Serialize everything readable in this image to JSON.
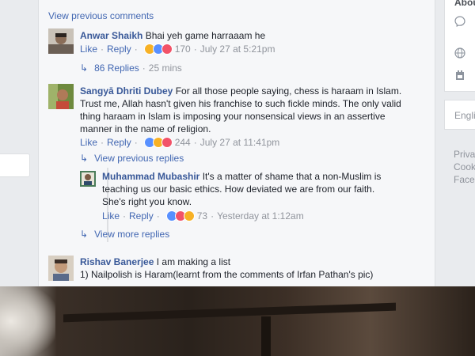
{
  "colors": {
    "link": "#4267b2",
    "author": "#385898",
    "meta": "#90949c",
    "background": "#e9ebee"
  },
  "view_previous_comments": "View previous comments",
  "actions": {
    "like": "Like",
    "reply": "Reply",
    "dot": "·"
  },
  "comments": [
    {
      "author": "Anwar Shaikh",
      "text": "Bhai yeh game harraaam he",
      "reactions": [
        "haha",
        "like",
        "love"
      ],
      "reaction_count": "170",
      "time": "July 27 at 5:21pm",
      "replies_label": "86 Replies",
      "replies_time": "25 mins"
    },
    {
      "author": "Sangyā Dhriti Dubey",
      "text": "For all those people saying, chess is haraam in Islam. Trust me, Allah hasn't given his franchise to such fickle minds. The only valid thing haraam in Islam is imposing your nonsensical views in an assertive manner in the name of religion.",
      "reactions": [
        "like",
        "haha",
        "love"
      ],
      "reaction_count": "244",
      "time": "July 27 at 11:41pm",
      "view_previous_replies": "View previous replies",
      "reply": {
        "author": "Muhammad Mubashir",
        "text": "It's a matter of shame that a non-Muslim is teaching us our basic ethics. How deviated we are from our faith. She's right you know.",
        "reactions": [
          "like",
          "love",
          "haha"
        ],
        "reaction_count": "73",
        "time": "Yesterday at 1:12am"
      },
      "view_more_replies": "View more replies"
    },
    {
      "author": "Rishav Banerjee",
      "text": "I am making a list",
      "line2": "1) Nailpolish is Haram(learnt from the comments of Irfan Pathan's pic)"
    }
  ],
  "right_panel": {
    "header_partial": "Abou",
    "icons": [
      "messenger-icon",
      "globe-icon",
      "calendar-icon"
    ],
    "language_partial": "Engli",
    "links": [
      "Priva",
      "Cook",
      "Face"
    ]
  }
}
